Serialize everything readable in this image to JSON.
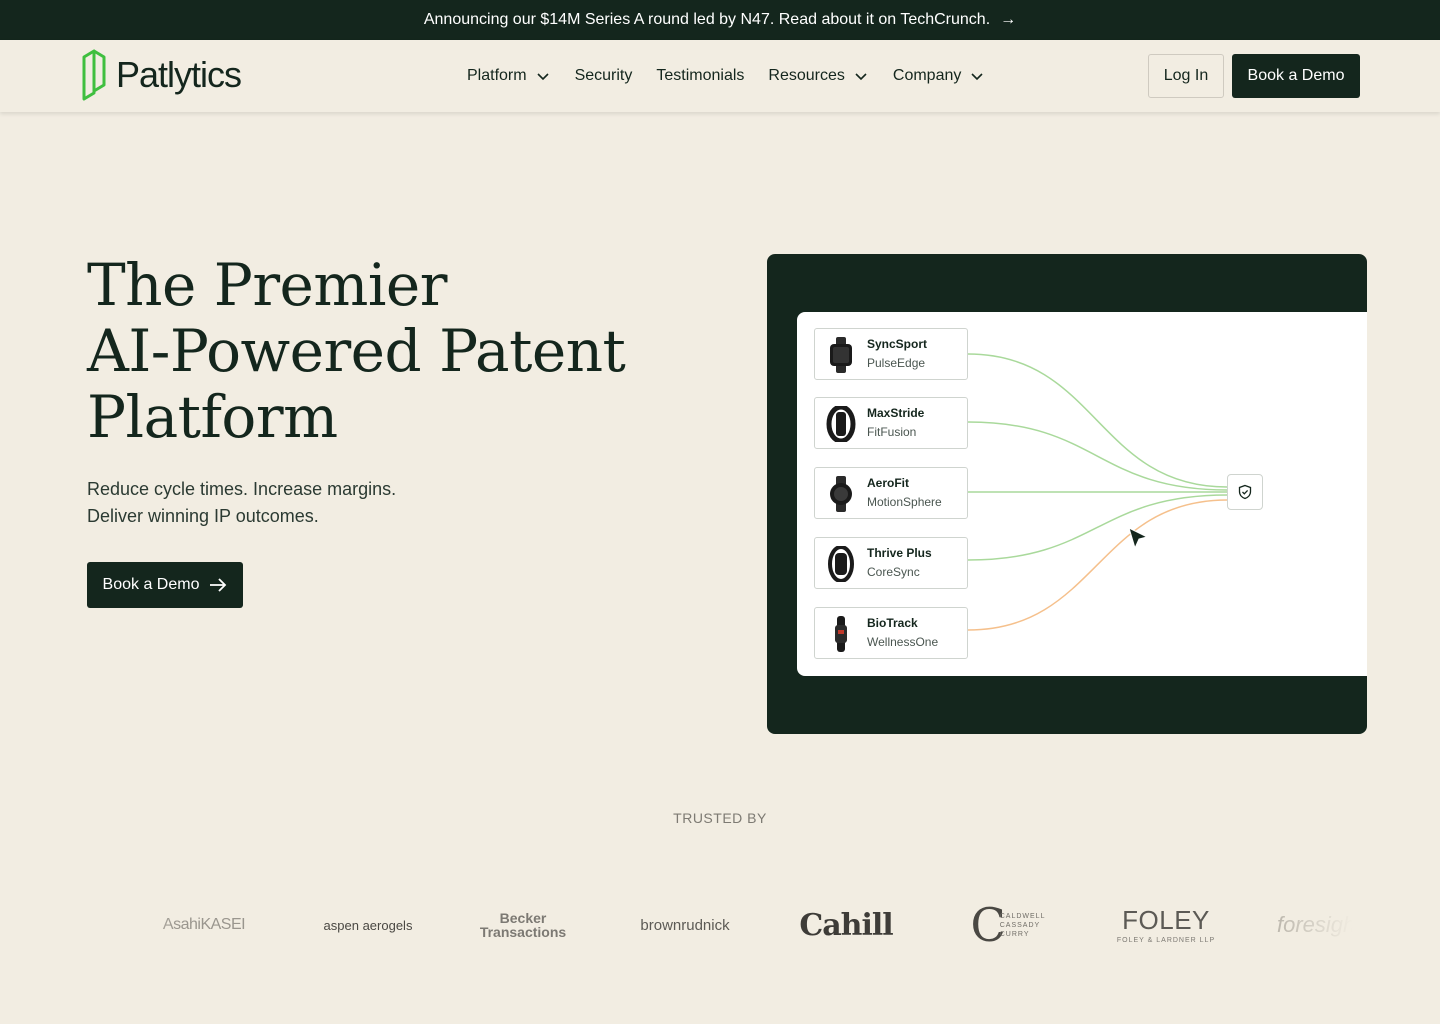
{
  "announcement": {
    "text": "Announcing our $14M Series A round led by N47. Read about it on TechCrunch.",
    "arrow": "→"
  },
  "nav": {
    "logo_text": "Patlytics",
    "items": [
      {
        "label": "Platform",
        "dropdown": true
      },
      {
        "label": "Security",
        "dropdown": false
      },
      {
        "label": "Testimonials",
        "dropdown": false
      },
      {
        "label": "Resources",
        "dropdown": true
      },
      {
        "label": "Company",
        "dropdown": true
      }
    ],
    "login_label": "Log In",
    "demo_label": "Book a Demo"
  },
  "hero": {
    "title_lines": [
      "The Premier",
      "AI-Powered Patent",
      "Platform"
    ],
    "subtitle_lines": [
      "Reduce cycle times. Increase margins.",
      "Deliver winning IP outcomes."
    ],
    "cta_label": "Book a Demo"
  },
  "diagram": {
    "products": [
      {
        "name": "SyncSport",
        "brand": "PulseEdge",
        "link_color": "green"
      },
      {
        "name": "MaxStride",
        "brand": "FitFusion",
        "link_color": "green"
      },
      {
        "name": "AeroFit",
        "brand": "MotionSphere",
        "link_color": "green"
      },
      {
        "name": "Thrive Plus",
        "brand": "CoreSync",
        "link_color": "green"
      },
      {
        "name": "BioTrack",
        "brand": "WellnessOne",
        "link_color": "orange"
      }
    ],
    "target_icon": "shield-check-icon"
  },
  "trusted": {
    "label": "TRUSTED BY",
    "logos": [
      "AsahiKASEI",
      "aspen aerogels",
      "Becker Transactions",
      "brownrudnick",
      "Cahill",
      "Caldwell Cassady Curry",
      "FOLEY",
      "foresight"
    ],
    "foley_sub": "FOLEY & LARDNER LLP",
    "caldwell_lines": [
      "CALDWELL",
      "CASSADY",
      "CURRY"
    ]
  },
  "colors": {
    "brand_dark": "#14261d",
    "background": "#f2ede2",
    "logo_green": "#3fbf3f",
    "link_green": "#a9d99b",
    "link_orange": "#f5c08c"
  }
}
